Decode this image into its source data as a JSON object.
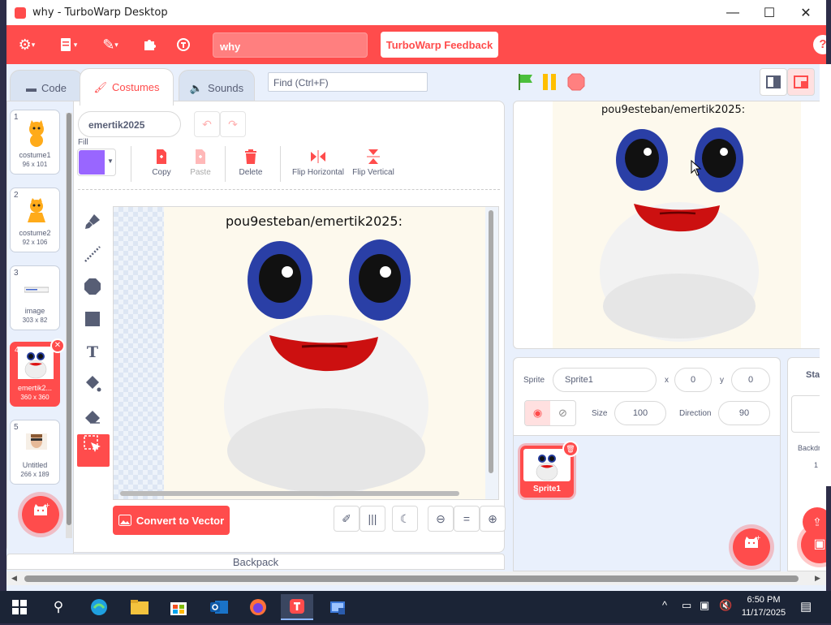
{
  "window": {
    "title": "why - TurboWarp Desktop",
    "minimize": "—",
    "maximize": "☐",
    "close": "✕"
  },
  "menu": {
    "project_title": "why",
    "feedback_label": "TurboWarp Feedback",
    "help": "?"
  },
  "tabs": [
    {
      "label": "Code",
      "icon": "code-icon"
    },
    {
      "label": "Costumes",
      "icon": "brush-icon"
    },
    {
      "label": "Sounds",
      "icon": "speaker-icon"
    }
  ],
  "find_placeholder": "Find (Ctrl+F)",
  "costumes": [
    {
      "num": "1",
      "name": "costume1",
      "size": "96 x 101"
    },
    {
      "num": "2",
      "name": "costume2",
      "size": "92 x 106"
    },
    {
      "num": "3",
      "name": "image",
      "size": "303 x 82"
    },
    {
      "num": "4",
      "name": "emertik2...",
      "size": "360 x 360",
      "selected": true
    },
    {
      "num": "5",
      "name": "Untitled",
      "size": "266 x 189"
    }
  ],
  "paint": {
    "costume_name": "emertik2025",
    "fill_label": "Fill",
    "fill_color": "#9966ff",
    "actions": {
      "copy": "Copy",
      "paste": "Paste",
      "delete": "Delete",
      "flip_h": "Flip Horizontal",
      "flip_v": "Flip Vertical"
    },
    "convert_label": "Convert to Vector",
    "zoom_reset": "="
  },
  "image_caption": "pou9esteban/emertik2025:",
  "backpack_label": "Backpack",
  "sprite": {
    "label": "Sprite",
    "name": "Sprite1",
    "x_label": "x",
    "x": "0",
    "y_label": "y",
    "y": "0",
    "size_label": "Size",
    "size": "100",
    "direction_label": "Direction",
    "direction": "90",
    "tile_name": "Sprite1"
  },
  "stage_pane": {
    "title": "Stage",
    "backdrops_label": "Backdro",
    "backdrops_count": "1"
  },
  "colors": {
    "accent": "#ff4c4c",
    "workspace_bg": "#e9f0fc",
    "taskbar": "#1b2436"
  },
  "taskbar": {
    "time": "6:50 PM",
    "date": "11/17/2025"
  }
}
